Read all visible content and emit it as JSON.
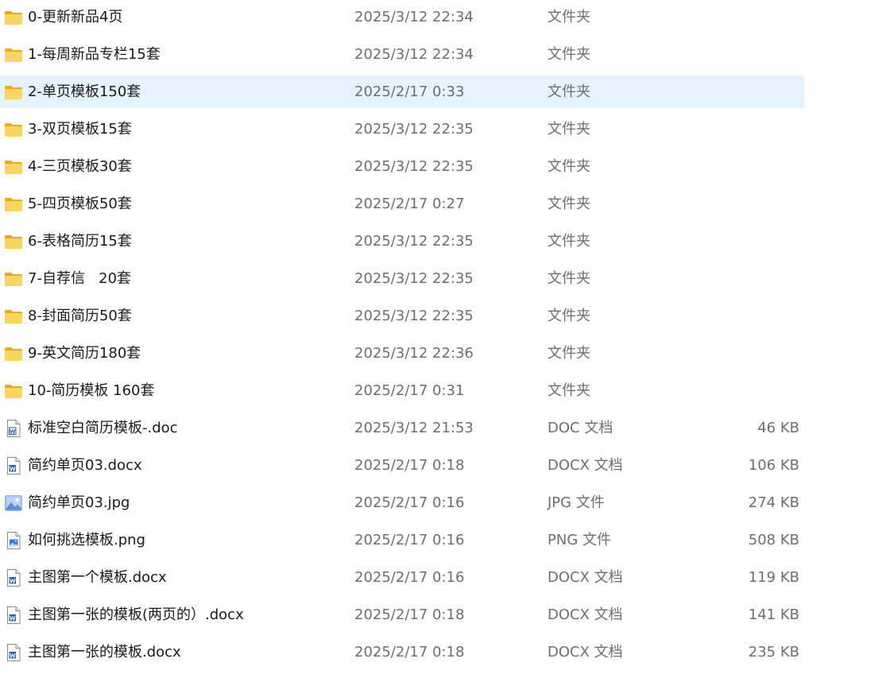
{
  "colors": {
    "selection_bg": "#e5f3ff",
    "folder_yellow": "#f8c843",
    "word_blue": "#2b5fb3",
    "text_primary": "#1a1a1a",
    "text_secondary": "#6e6e6e"
  },
  "selected_index": 2,
  "files": [
    {
      "name": "0-更新新品4页",
      "date": "2025/3/12 22:34",
      "type": "文件夹",
      "size": "",
      "icon": "folder-icon"
    },
    {
      "name": "1-每周新品专栏15套",
      "date": "2025/3/12 22:34",
      "type": "文件夹",
      "size": "",
      "icon": "folder-icon"
    },
    {
      "name": "2-单页模板150套",
      "date": "2025/2/17 0:33",
      "type": "文件夹",
      "size": "",
      "icon": "folder-icon"
    },
    {
      "name": "3-双页模板15套",
      "date": "2025/3/12 22:35",
      "type": "文件夹",
      "size": "",
      "icon": "folder-icon"
    },
    {
      "name": "4-三页模板30套",
      "date": "2025/3/12 22:35",
      "type": "文件夹",
      "size": "",
      "icon": "folder-icon"
    },
    {
      "name": "5-四页模板50套",
      "date": "2025/2/17 0:27",
      "type": "文件夹",
      "size": "",
      "icon": "folder-icon"
    },
    {
      "name": "6-表格简历15套",
      "date": "2025/3/12 22:35",
      "type": "文件夹",
      "size": "",
      "icon": "folder-icon"
    },
    {
      "name": "7-自荐信   20套",
      "date": "2025/3/12 22:35",
      "type": "文件夹",
      "size": "",
      "icon": "folder-icon"
    },
    {
      "name": "8-封面简历50套",
      "date": "2025/3/12 22:35",
      "type": "文件夹",
      "size": "",
      "icon": "folder-icon"
    },
    {
      "name": "9-英文简历180套",
      "date": "2025/3/12 22:36",
      "type": "文件夹",
      "size": "",
      "icon": "folder-icon"
    },
    {
      "name": "10-简历模板 160套",
      "date": "2025/2/17 0:31",
      "type": "文件夹",
      "size": "",
      "icon": "folder-icon"
    },
    {
      "name": "标准空白简历模板-.doc",
      "date": "2025/3/12 21:53",
      "type": "DOC 文档",
      "size": "46 KB",
      "icon": "word-doc-icon"
    },
    {
      "name": "简约单页03.docx",
      "date": "2025/2/17 0:18",
      "type": "DOCX 文档",
      "size": "106 KB",
      "icon": "word-docx-icon"
    },
    {
      "name": "简约单页03.jpg",
      "date": "2025/2/17 0:16",
      "type": "JPG 文件",
      "size": "274 KB",
      "icon": "image-icon"
    },
    {
      "name": "如何挑选模板.png",
      "date": "2025/2/17 0:16",
      "type": "PNG 文件",
      "size": "508 KB",
      "icon": "png-file-icon"
    },
    {
      "name": "主图第一个模板.docx",
      "date": "2025/2/17 0:16",
      "type": "DOCX 文档",
      "size": "119 KB",
      "icon": "word-docx-icon"
    },
    {
      "name": "主图第一张的模板(两页的）.docx",
      "date": "2025/2/17 0:18",
      "type": "DOCX 文档",
      "size": "141 KB",
      "icon": "word-docx-icon"
    },
    {
      "name": "主图第一张的模板.docx",
      "date": "2025/2/17 0:18",
      "type": "DOCX 文档",
      "size": "235 KB",
      "icon": "word-docx-icon"
    }
  ]
}
